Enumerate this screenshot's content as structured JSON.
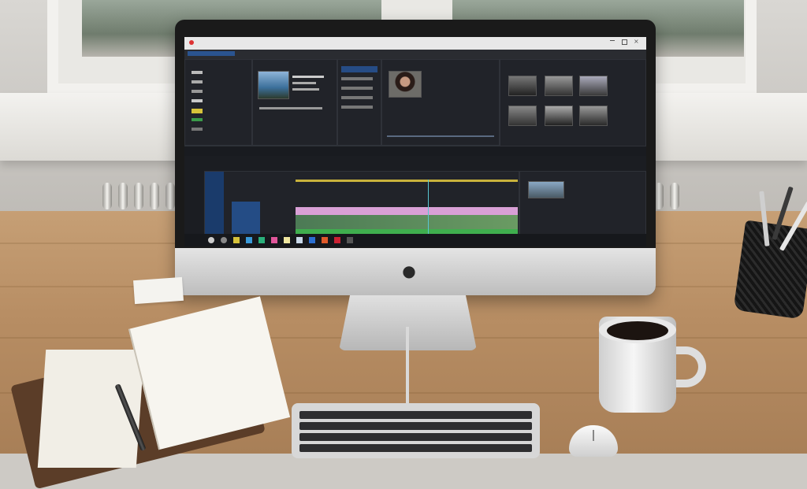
{
  "scene": {
    "description_tags": [
      "imac-desk",
      "video-editing-software"
    ],
    "colors": {
      "desk": "#b78d63",
      "screen_bg": "#1b1d22",
      "accent_blue": "#2b6fd1",
      "timeline_pink": "#d9a0d6",
      "timeline_green": "#3fae4e"
    },
    "icons": [
      "apple-logo-icon",
      "minimize-icon",
      "maximize-icon",
      "close-icon"
    ]
  }
}
